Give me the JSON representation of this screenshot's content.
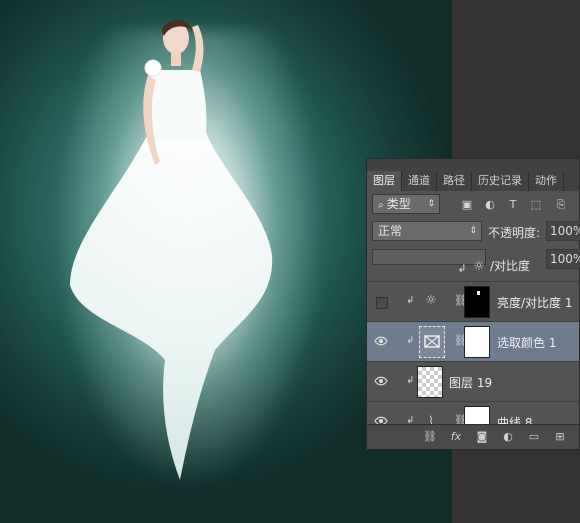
{
  "panel": {
    "tabs": [
      "图层",
      "通道",
      "路径",
      "历史记录",
      "动作"
    ],
    "filter_label": "类型",
    "blend_mode": "正常",
    "opacity_label": "不透明度:",
    "opacity_value": "100%",
    "fill_value": "100%",
    "hidden_layer_name": "/对比度",
    "layers": [
      {
        "name": "亮度/对比度 1",
        "visible": false,
        "selected": false
      },
      {
        "name": "选取颜色 1",
        "visible": true,
        "selected": true
      },
      {
        "name": "图层 19",
        "visible": true,
        "selected": false
      },
      {
        "name": "曲线 8",
        "visible": true,
        "selected": false
      }
    ]
  },
  "colors": {
    "canvas_bg": "#1f4c47",
    "panel_bg": "#535353",
    "selected_row": "#6f7c8f"
  }
}
